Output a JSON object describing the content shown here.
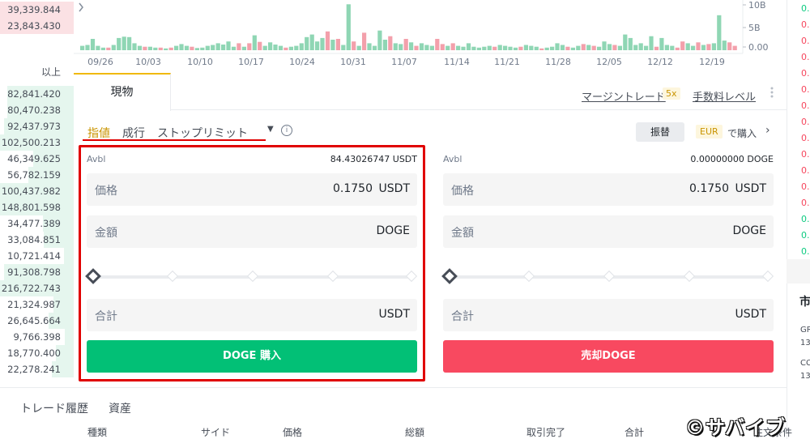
{
  "orderbook": {
    "asks": [
      {
        "amount": "39,339.844",
        "depth": 1.0
      },
      {
        "amount": "23,843.430",
        "depth": 1.0
      }
    ],
    "mid_label": "以上",
    "bids": [
      {
        "amount": "82,841.420",
        "depth": 0.9
      },
      {
        "amount": "80,470.238",
        "depth": 0.9
      },
      {
        "amount": "92,437.973",
        "depth": 0.95
      },
      {
        "amount": "102,500.213",
        "depth": 1.0
      },
      {
        "amount": "46,349.625",
        "depth": 0.55
      },
      {
        "amount": "56,782.159",
        "depth": 0.62
      },
      {
        "amount": "100,437.982",
        "depth": 1.0
      },
      {
        "amount": "148,801.598",
        "depth": 1.0
      },
      {
        "amount": "34,477.389",
        "depth": 0.42
      },
      {
        "amount": "33,084.851",
        "depth": 0.41
      },
      {
        "amount": "10,721.414",
        "depth": 0.13
      },
      {
        "amount": "91,308.798",
        "depth": 0.95
      },
      {
        "amount": "216,722.743",
        "depth": 1.0
      },
      {
        "amount": "21,324.987",
        "depth": 0.28
      },
      {
        "amount": "26,645.664",
        "depth": 0.34
      },
      {
        "amount": "9,766.398",
        "depth": 0.12
      },
      {
        "amount": "18,770.400",
        "depth": 0.24
      },
      {
        "amount": "22,278.241",
        "depth": 0.3
      }
    ]
  },
  "chart": {
    "toggle_icon": "chevron-icon",
    "x_ticks": [
      "09/26",
      "10/03",
      "10/10",
      "10/17",
      "10/24",
      "10/31",
      "11/07",
      "11/14",
      "11/21",
      "11/28",
      "12/05",
      "12/12",
      "12/19"
    ],
    "y_ticks": [
      "10B",
      "5B",
      "0.00"
    ],
    "colors": {
      "up": "#8fd6b4",
      "down": "#f3a0ab"
    }
  },
  "chart_data": {
    "type": "bar",
    "ylim": [
      0,
      10
    ],
    "values": [
      1.0,
      1.2,
      2.6,
      1.0,
      0.6,
      0.6,
      1.2,
      2.8,
      3.1,
      3.0,
      1.6,
      1.0,
      0.8,
      0.8,
      0.6,
      0.6,
      0.4,
      0.6,
      1.0,
      1.4,
      1.0,
      0.8,
      0.5,
      0.6,
      1.0,
      1.2,
      1.6,
      1.3,
      2.0,
      0.8,
      1.6,
      0.8,
      1.6,
      3.4,
      1.9,
      1.0,
      1.8,
      1.3,
      1.0,
      0.6,
      0.8,
      1.0,
      1.6,
      3.0,
      3.6,
      2.0,
      2.8,
      4.3,
      2.4,
      2.6,
      1.2,
      1.6,
      2.0,
      1.0,
      4.0,
      1.6,
      1.0,
      4.5,
      2.4,
      3.2,
      1.6,
      1.4,
      2.6,
      1.8,
      1.0,
      1.6,
      1.2,
      1.0,
      2.6,
      1.4,
      1.0,
      1.6,
      1.0,
      0.8,
      1.6,
      0.8,
      0.6,
      0.8,
      1.0,
      0.8,
      1.2,
      1.0,
      0.8,
      0.6,
      0.8,
      1.2,
      1.0,
      0.8,
      0.4,
      0.6,
      0.8,
      1.6,
      1.2,
      0.8,
      0.6,
      1.0,
      1.4,
      1.2,
      1.0,
      0.8,
      2.0,
      1.4,
      1.2,
      1.0,
      3.6,
      2.8,
      1.2,
      1.6,
      1.0,
      3.2,
      0.8,
      2.8,
      1.2,
      1.0,
      0.6,
      2.0,
      1.6,
      1.0,
      1.8,
      1.2,
      1.4,
      1.6,
      8.0,
      2.2,
      1.8,
      1.0
    ],
    "directions": [
      "u",
      "u",
      "u",
      "u",
      "u",
      "d",
      "u",
      "u",
      "u",
      "u",
      "u",
      "u",
      "d",
      "u",
      "u",
      "d",
      "u",
      "d",
      "u",
      "u",
      "u",
      "d",
      "u",
      "u",
      "u",
      "u",
      "u",
      "u",
      "u",
      "u",
      "d",
      "u",
      "d",
      "u",
      "d",
      "u",
      "u",
      "u",
      "u",
      "d",
      "u",
      "u",
      "u",
      "u",
      "u",
      "u",
      "u",
      "d",
      "u",
      "d",
      "u",
      "u",
      "d",
      "u",
      "d",
      "u",
      "u",
      "u",
      "u",
      "d",
      "u",
      "u",
      "d",
      "u",
      "d",
      "u",
      "u",
      "u",
      "d",
      "d",
      "u",
      "d",
      "u",
      "u",
      "u",
      "u",
      "u",
      "u",
      "u",
      "d",
      "u",
      "u",
      "u",
      "u",
      "d",
      "u",
      "u",
      "u",
      "d",
      "u",
      "u",
      "u",
      "u",
      "d",
      "u",
      "u",
      "d",
      "u",
      "d",
      "u",
      "u",
      "u",
      "d",
      "u",
      "u",
      "u",
      "u",
      "u",
      "u",
      "u",
      "d",
      "u",
      "u",
      "u",
      "d",
      "d",
      "u",
      "u",
      "d",
      "u",
      "d",
      "u",
      "u",
      "u",
      "d",
      "d"
    ],
    "highlight": {
      "index": 51,
      "value": 10.5
    }
  },
  "tabs": {
    "spot": "現物",
    "margin_trade": "マージントレード",
    "leverage": "5x",
    "fee_level": "手数料レベル",
    "more_icon": "more-vertical-icon"
  },
  "order_types": {
    "limit": "指値",
    "market": "成行",
    "stop_limit": "ストップリミット",
    "caret_icon": "caret-down-icon",
    "info": "i"
  },
  "actions": {
    "swap": "振替",
    "currency": "EUR",
    "buy_with": "で購入",
    "arrow": "›"
  },
  "buy": {
    "avbl_label": "Avbl",
    "avbl_value": "84.43026747 USDT",
    "price_label": "価格",
    "price_value": "0.1750",
    "price_unit": "USDT",
    "amount_label": "金額",
    "amount_unit": "DOGE",
    "total_label": "合計",
    "total_unit": "USDT",
    "button": "DOGE 購入"
  },
  "sell": {
    "avbl_label": "Avbl",
    "avbl_value": "0.00000000 DOGE",
    "price_label": "価格",
    "price_value": "0.1750",
    "price_unit": "USDT",
    "amount_label": "金額",
    "amount_unit": "DOGE",
    "total_label": "合計",
    "total_unit": "USDT",
    "button": "売却DOGE"
  },
  "right_column": {
    "prices": [
      {
        "text": "0.",
        "color": "green"
      },
      {
        "text": "0.",
        "color": "red"
      },
      {
        "text": "0.",
        "color": "red"
      },
      {
        "text": "0.",
        "color": "red"
      },
      {
        "text": "0.",
        "color": "red"
      },
      {
        "text": "0.",
        "color": "red"
      },
      {
        "text": "0.",
        "color": "red"
      },
      {
        "text": "0.",
        "color": "red"
      },
      {
        "text": "0.",
        "color": "red"
      },
      {
        "text": "0.",
        "color": "red"
      },
      {
        "text": "0.",
        "color": "red"
      },
      {
        "text": "0.",
        "color": "red"
      },
      {
        "text": "0.",
        "color": "red"
      },
      {
        "text": "0.",
        "color": "green"
      },
      {
        "text": "0.",
        "color": "green"
      },
      {
        "text": "0.",
        "color": "green"
      }
    ],
    "title": "市",
    "lines": [
      "GR",
      "13",
      "CC",
      "13"
    ]
  },
  "bottom": {
    "tabs": [
      "トレード履歴",
      "資産"
    ],
    "columns": [
      "種類",
      "サイド",
      "価格",
      "総額",
      "取引完了",
      "合計",
      "注文条件"
    ]
  },
  "watermark": "©サバイブ"
}
